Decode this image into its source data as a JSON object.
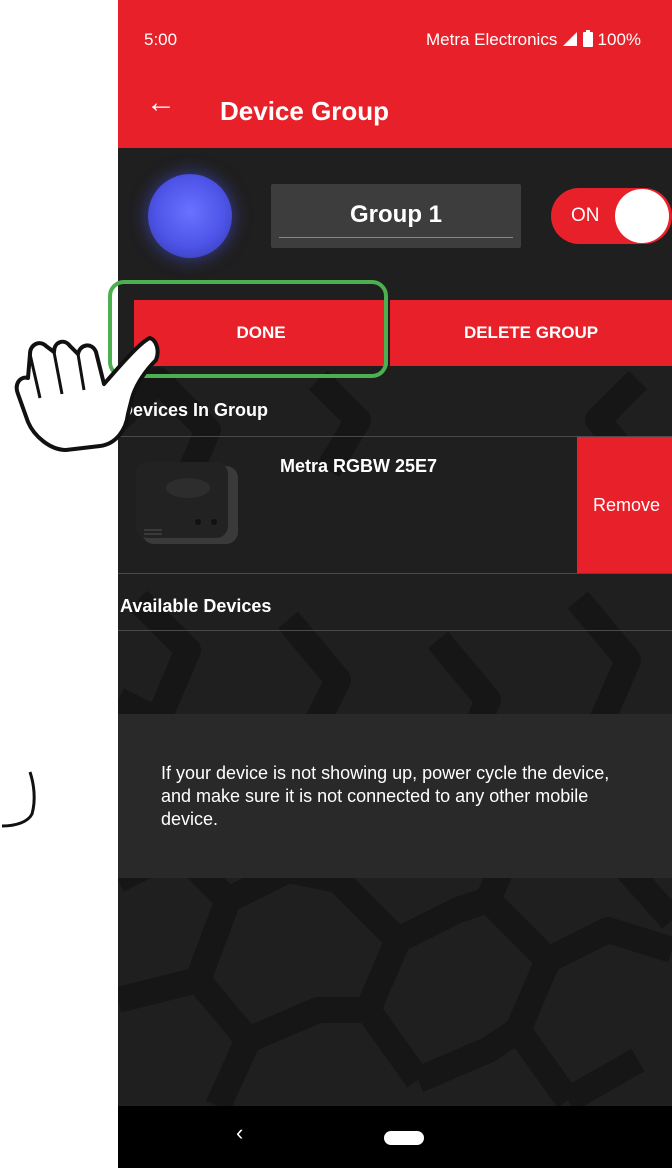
{
  "status_bar": {
    "time": "5:00",
    "carrier": "Metra Electronics",
    "battery": "100%"
  },
  "app_bar": {
    "title": "Device Group"
  },
  "group": {
    "name": "Group 1",
    "power_label": "ON",
    "color": "#4d54e8"
  },
  "actions": {
    "done_label": "DONE",
    "delete_label": "DELETE GROUP"
  },
  "devices_in_group": {
    "heading": "Devices In Group",
    "items": [
      {
        "name": "Metra RGBW 25E7",
        "remove_label": "Remove"
      }
    ]
  },
  "available_devices": {
    "heading": "Available Devices",
    "help_text": "If your device is not showing up, power cycle the device, and make sure it is not connected to any other mobile device."
  },
  "nav_bar": {
    "back_glyph": "‹"
  },
  "colors": {
    "accent": "#e8202a",
    "highlight": "#4caf50",
    "background": "#1f1f1f"
  }
}
